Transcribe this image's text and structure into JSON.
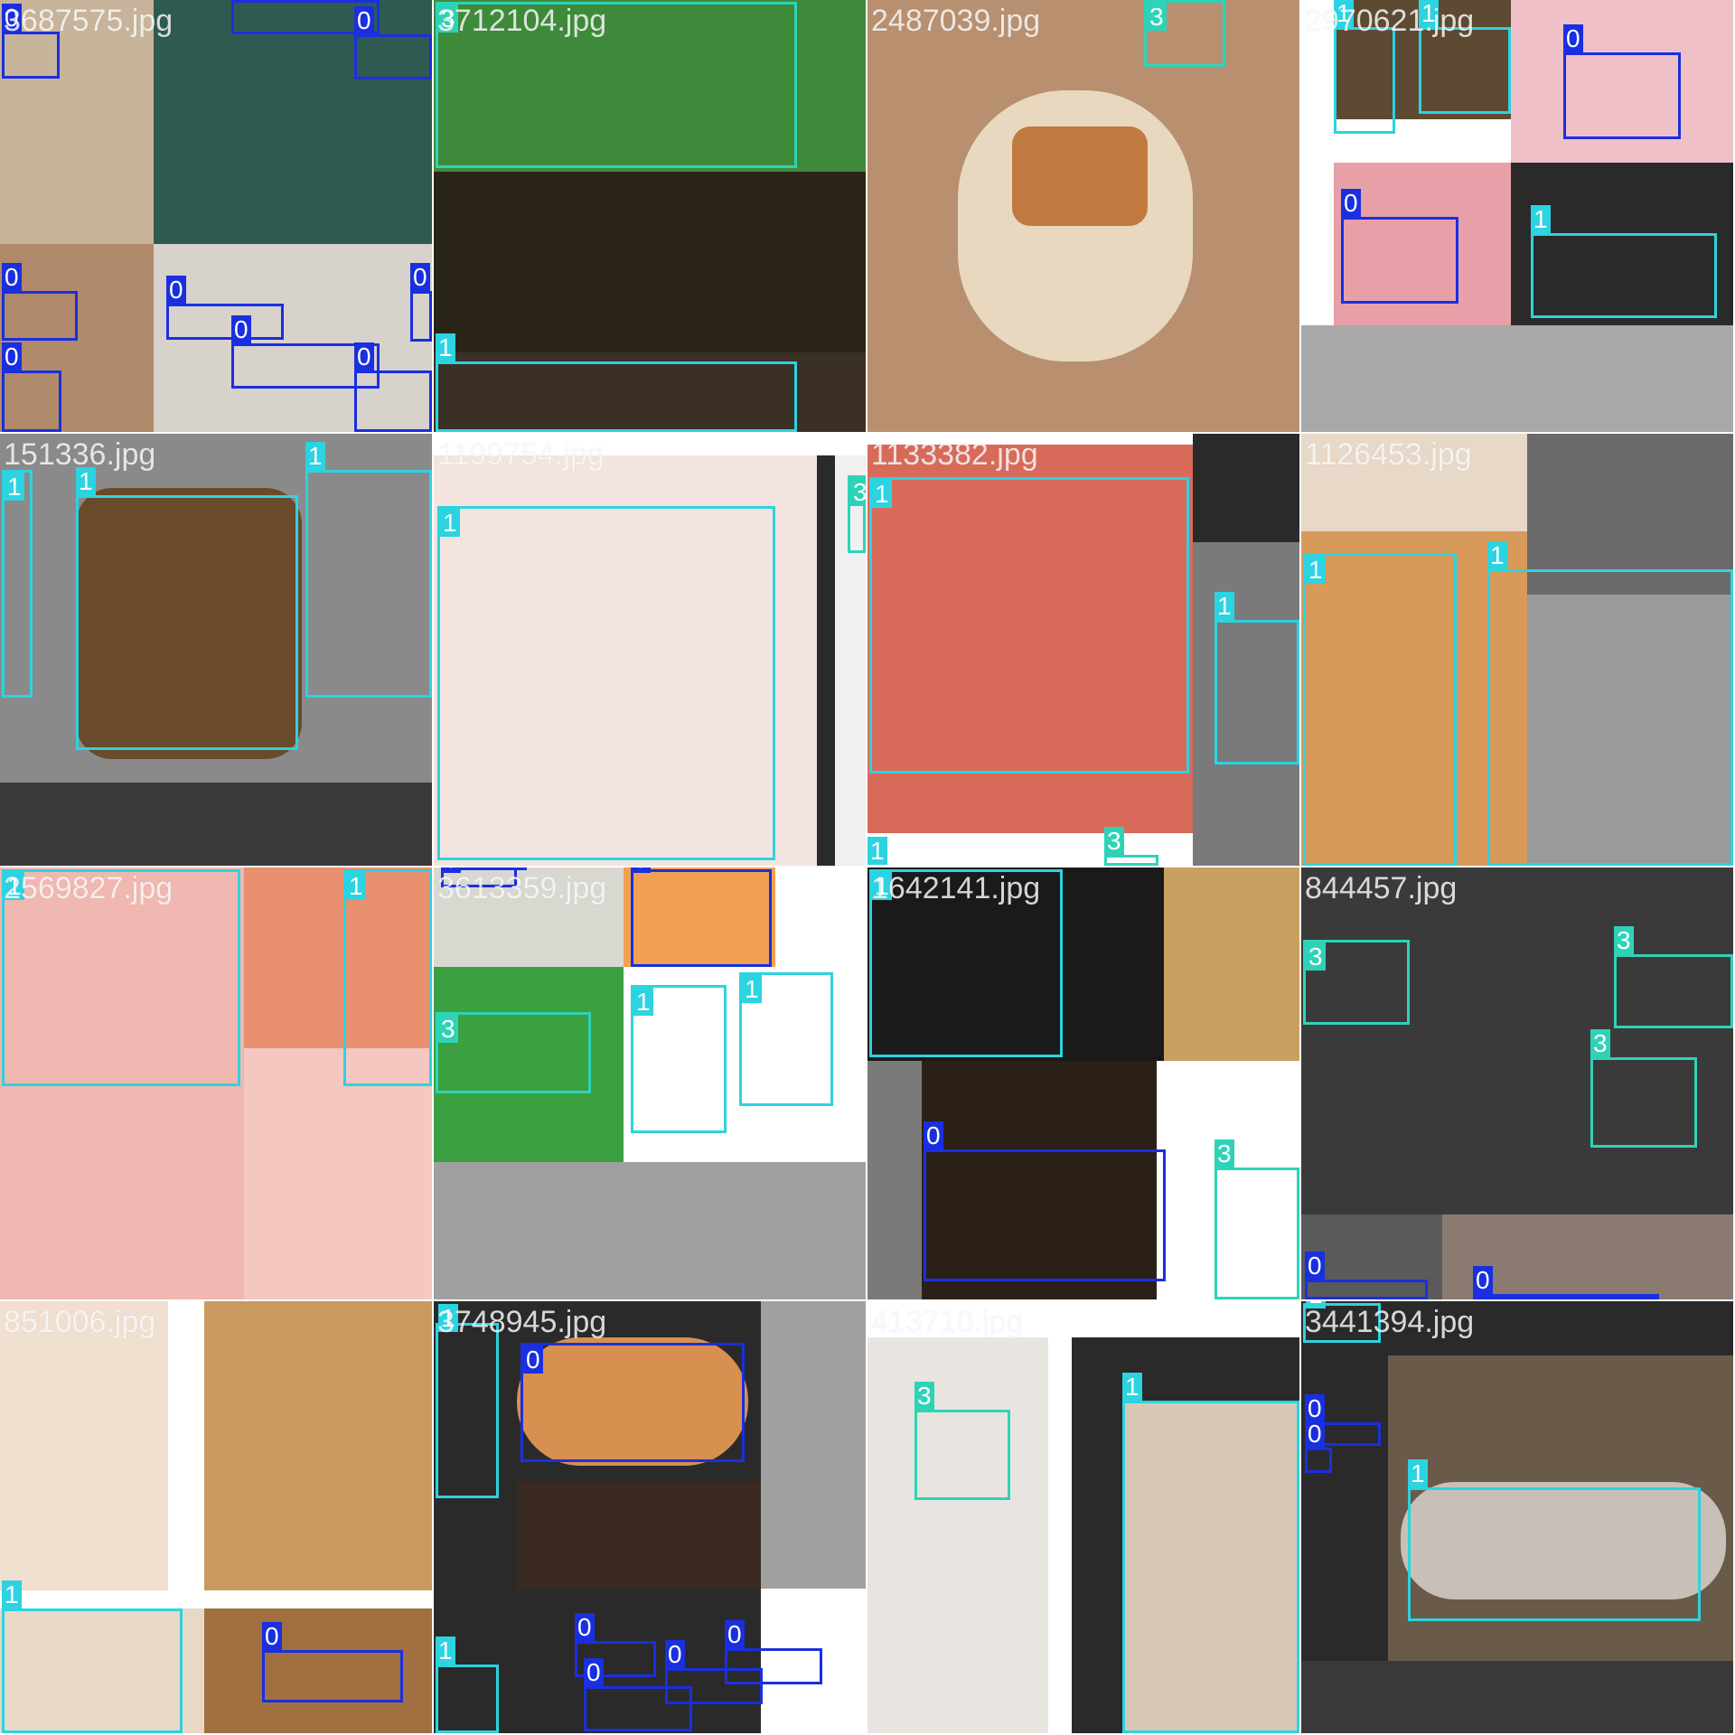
{
  "tiles": [
    {
      "filename": "3687575.jpg",
      "patches": [
        "#c8b49a",
        "#2f5a52",
        "#b08a6a",
        "#d8d2cc"
      ],
      "boxes": [
        {
          "cls": "0"
        },
        {
          "cls": "0"
        },
        {
          "cls": "0"
        },
        {
          "cls": "0"
        },
        {
          "cls": "0"
        },
        {
          "cls": "0"
        },
        {
          "cls": "0"
        },
        {
          "cls": "0"
        },
        {
          "cls": "0"
        }
      ]
    },
    {
      "filename": "3712104.jpg",
      "patches": [
        "#3f8a3a",
        "#2a2418",
        "#3a3026"
      ],
      "boxes": [
        {
          "cls": "3"
        },
        {
          "cls": "1"
        }
      ]
    },
    {
      "filename": "2487039.jpg",
      "patches": [
        "#b89070",
        "#e8d8c0",
        "#c07a40"
      ],
      "boxes": [
        {
          "cls": "3"
        }
      ]
    },
    {
      "filename": "2970621.jpg",
      "patches": [
        "#5e4a32",
        "#f0c0c8",
        "#e8a0a8",
        "#2a2a2a",
        "#a8a8a8"
      ],
      "boxes": [
        {
          "cls": "1"
        },
        {
          "cls": "1"
        },
        {
          "cls": "0"
        },
        {
          "cls": "0"
        },
        {
          "cls": "1"
        }
      ]
    },
    {
      "filename": "151336.jpg",
      "patches": [
        "#8a8a8a",
        "#6a4a2a",
        "#3a3a3a"
      ],
      "boxes": [
        {
          "cls": "1"
        },
        {
          "cls": "1"
        },
        {
          "cls": "1"
        }
      ]
    },
    {
      "filename": "1199754.jpg",
      "patches": [
        "#f4e4e0",
        "#2a2a2a",
        "#f0f0f0"
      ],
      "boxes": [
        {
          "cls": "1"
        },
        {
          "cls": "3"
        }
      ]
    },
    {
      "filename": "1133382.jpg",
      "patches": [
        "#d86a5a",
        "#2a2a2a",
        "#7a7a7a"
      ],
      "boxes": [
        {
          "cls": "1"
        },
        {
          "cls": "1"
        },
        {
          "cls": "1"
        },
        {
          "cls": "3"
        }
      ]
    },
    {
      "filename": "1126453.jpg",
      "patches": [
        "#e8d8c8",
        "#d89a5a",
        "#9a9a9a",
        "#6a6a6a"
      ],
      "boxes": [
        {
          "cls": "1"
        },
        {
          "cls": "1"
        }
      ]
    },
    {
      "filename": "2569827.jpg",
      "patches": [
        "#f0b8b0",
        "#e89070",
        "#f4c8c0"
      ],
      "boxes": [
        {
          "cls": "1"
        },
        {
          "cls": "1"
        }
      ]
    },
    {
      "filename": "3613359.jpg",
      "patches": [
        "#d8d8d0",
        "#f0a050",
        "#3aa040",
        "#a0a0a0"
      ],
      "boxes": [
        {
          "cls": "0"
        },
        {
          "cls": "0"
        },
        {
          "cls": "0"
        },
        {
          "cls": "3"
        },
        {
          "cls": "1"
        },
        {
          "cls": "1"
        }
      ]
    },
    {
      "filename": "1642141.jpg",
      "patches": [
        "#1a1a1a",
        "#c8a060",
        "#2a2018",
        "#7a7a7a"
      ],
      "boxes": [
        {
          "cls": "1"
        },
        {
          "cls": "0"
        },
        {
          "cls": "3"
        }
      ]
    },
    {
      "filename": "844457.jpg",
      "patches": [
        "#3a3a3a",
        "#5a5a5a",
        "#8a7a70"
      ],
      "boxes": [
        {
          "cls": "3"
        },
        {
          "cls": "3"
        },
        {
          "cls": "3"
        },
        {
          "cls": "0"
        },
        {
          "cls": "0"
        }
      ]
    },
    {
      "filename": "851006.jpg",
      "patches": [
        "#f0e0d0",
        "#c89a60",
        "#e8d8c8",
        "#a07040"
      ],
      "boxes": [
        {
          "cls": "1"
        },
        {
          "cls": "0"
        }
      ]
    },
    {
      "filename": "3748945.jpg",
      "patches": [
        "#2a2a2a",
        "#d89050",
        "#a0a0a0",
        "#3a2a20"
      ],
      "boxes": [
        {
          "cls": "1"
        },
        {
          "cls": "0"
        },
        {
          "cls": "1"
        },
        {
          "cls": "0"
        },
        {
          "cls": "0"
        },
        {
          "cls": "0"
        },
        {
          "cls": "0"
        },
        {
          "cls": "0"
        }
      ]
    },
    {
      "filename": "413710.jpg",
      "patches": [
        "#e8e4e0",
        "#2a2a2a",
        "#d8c8b8"
      ],
      "boxes": [
        {
          "cls": "3"
        },
        {
          "cls": "1"
        }
      ]
    },
    {
      "filename": "3441394.jpg",
      "patches": [
        "#2a2a2a",
        "#6a5a4a",
        "#c8c0b8",
        "#3a3a3a"
      ],
      "boxes": [
        {
          "cls": "1"
        },
        {
          "cls": "0"
        },
        {
          "cls": "0"
        },
        {
          "cls": "0"
        },
        {
          "cls": "1"
        }
      ]
    }
  ]
}
